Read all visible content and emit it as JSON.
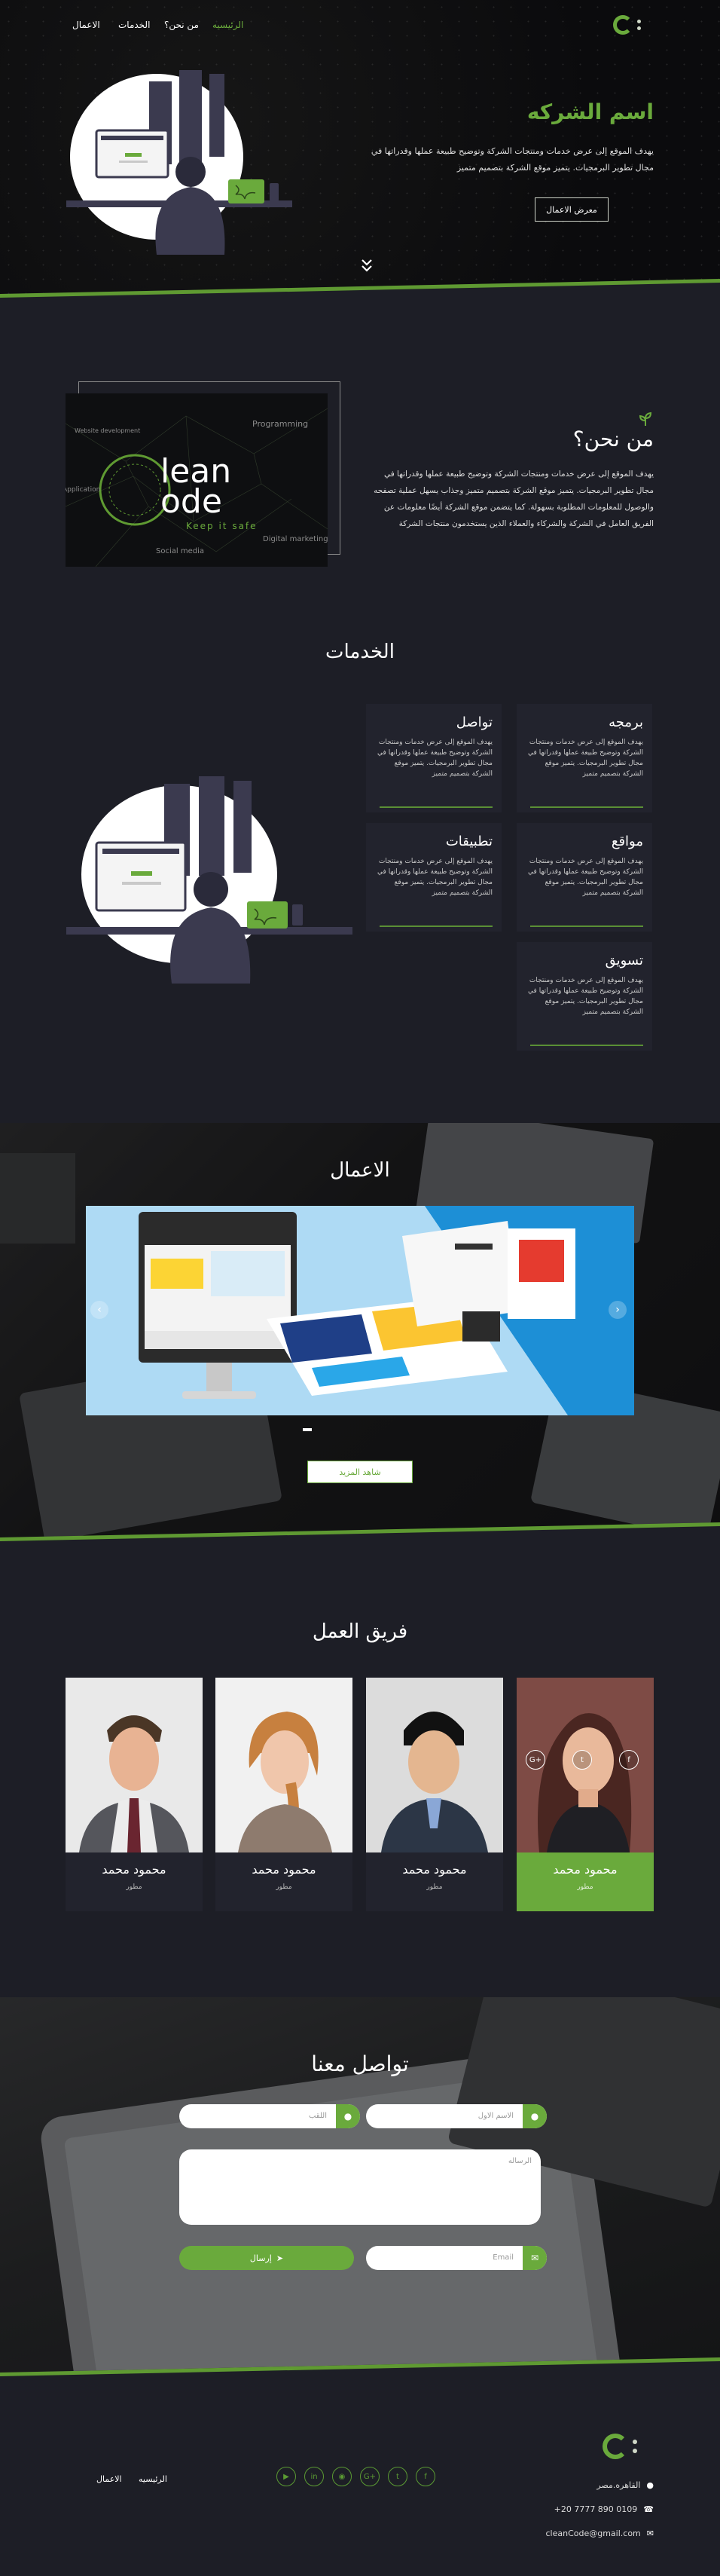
{
  "nav": {
    "links": [
      "الرئيسيه",
      "من نحن؟",
      "الخدمات",
      "الاعمال"
    ],
    "active_index": 0
  },
  "hero": {
    "title": "اسم الشركه",
    "description": "يهدف الموقع إلى عرض خدمات ومنتجات الشركة وتوضيح طبيعة عملها وقدراتها في مجال تطوير البرمجيات. يتميز موقع الشركة بتصميم متميز",
    "button": "معرض الاعمال",
    "scroll_icon": "double-chevron-down-icon"
  },
  "about": {
    "title": "من نحن؟",
    "description": "يهدف الموقع إلى عرض خدمات ومنتجات الشركة وتوضيح طبيعة عملها وقدراتها في مجال تطوير البرمجيات. يتميز موقع الشركة بتصميم متميز وجذاب يسهل عملية تصفحه والوصول للمعلومات المطلوبة بسهولة. كما يتضمن موقع الشركة أيضًا معلومات عن الفريق العامل في الشركة والشركاء والعملاء الذين يستخدمون منتجات الشركة",
    "image_brand": "CleanCode",
    "image_tagline": "Keep it safe",
    "image_words": [
      "Programming",
      "Website development",
      "Application",
      "Digital marketing",
      "Social media"
    ]
  },
  "services": {
    "title": "الخدمات",
    "description": "يهدف الموقع إلى عرض خدمات ومنتجات الشركة وتوضيح طبيعة عملها وقدراتها في مجال تطوير البرمجيات. يتميز موقع الشركة بتصميم متميز",
    "items": [
      "برمجه",
      "تواصل",
      "مواقع",
      "تطبيقات",
      "تسويق"
    ]
  },
  "works": {
    "title": "الاعمال",
    "button": "شاهد المزيد"
  },
  "team": {
    "title": "فريق العمل",
    "members": [
      {
        "name": "محمود محمد",
        "role": "مطور"
      },
      {
        "name": "محمود محمد",
        "role": "مطور"
      },
      {
        "name": "محمود محمد",
        "role": "مطور"
      },
      {
        "name": "محمود محمد",
        "role": "مطور"
      }
    ]
  },
  "contact": {
    "title": "تواصل معنا",
    "name_placeholder": "الاسم الاول",
    "surname_placeholder": "اللقب",
    "message_placeholder": "الرساله",
    "email_placeholder": "Email",
    "send": "إرسال"
  },
  "footer": {
    "nav": [
      "الرئيسيه",
      "الاعمال"
    ],
    "address": "القاهره.مصر",
    "phone": "+20 7777 890 0109",
    "email": "cleanCode@gmail.com",
    "socials": [
      "f",
      "t",
      "G+",
      "in-icon",
      "in",
      "yt"
    ]
  },
  "colors": {
    "accent": "#6aaa3c",
    "background": "#1d1e26",
    "card": "#22232d"
  }
}
